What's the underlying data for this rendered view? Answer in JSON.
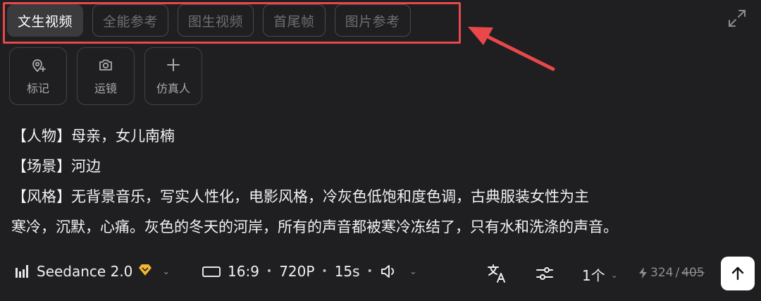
{
  "tabs": [
    {
      "label": "文生视频"
    },
    {
      "label": "全能参考"
    },
    {
      "label": "图生视频"
    },
    {
      "label": "首尾帧"
    },
    {
      "label": "图片参考"
    }
  ],
  "tools": [
    {
      "label": "标记",
      "icon": "pin-sparkle-icon"
    },
    {
      "label": "运镜",
      "icon": "camera-icon"
    },
    {
      "label": "仿真人",
      "icon": "plus-icon"
    }
  ],
  "prompt": {
    "line1": "【人物】母亲，女儿南楠",
    "line2": "【场景】河边",
    "line3": "【风格】无背景音乐，写实人性化，电影风格，冷灰色低饱和度色调，古典服装女性为主",
    "line4": "寒冷，沉默，心痛。灰色的冬天的河岸，所有的声音都被寒冷冻结了，只有水和洗涤的声音。"
  },
  "bottom": {
    "model_name": "Seedance 2.0",
    "ratio": "16:9",
    "resolution": "720P",
    "duration": "15s",
    "count": "1个",
    "credits_current": "324",
    "credits_sep": "/",
    "credits_original": "405"
  },
  "colors": {
    "background": "#1f1f21",
    "highlight": "#e8484a",
    "accent_gold": "#f5b532"
  }
}
